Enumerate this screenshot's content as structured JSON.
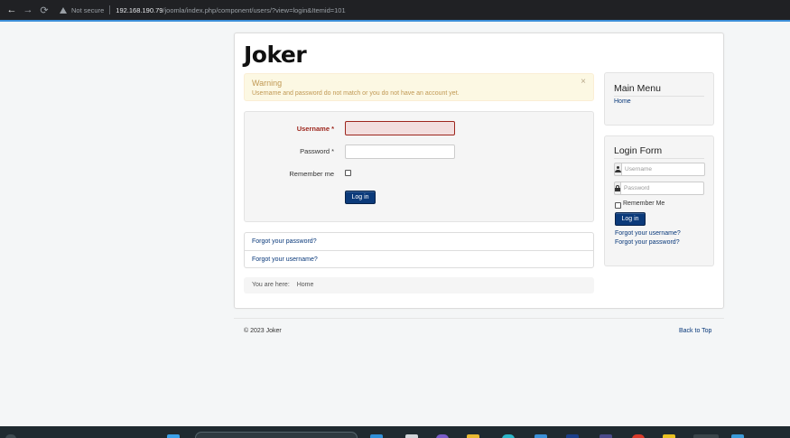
{
  "browser": {
    "security_label": "Not secure",
    "url_host": "192.168.190.79",
    "url_path": "/joomla/index.php/component/users/?view=login&Itemid=101"
  },
  "site": {
    "title": "Joker"
  },
  "alert": {
    "heading": "Warning",
    "message": "Username and password do not match or you do not have an account yet.",
    "close": "×"
  },
  "login": {
    "username_label": "Username *",
    "password_label": "Password *",
    "remember_label": "Remember me",
    "submit_label": "Log in",
    "username_value": "",
    "password_value": ""
  },
  "links": {
    "forgot_password": "Forgot your password?",
    "forgot_username": "Forgot your username?"
  },
  "breadcrumb": {
    "prefix": "You are here:",
    "home": "Home"
  },
  "main_menu": {
    "title": "Main Menu",
    "items": [
      {
        "label": "Home"
      }
    ]
  },
  "login_module": {
    "title": "Login Form",
    "username_placeholder": "Username",
    "password_placeholder": "Password",
    "remember_label": "Remember Me",
    "submit_label": "Log in",
    "forgot_username": "Forgot your username?",
    "forgot_password": "Forgot your password?"
  },
  "footer": {
    "copyright": "© 2023 Joker",
    "back_to_top": "Back to Top"
  },
  "colors": {
    "link": "#08387a",
    "primary_button": "#0b3a7a",
    "alert_bg": "#fcf8e3",
    "alert_text": "#c09853",
    "error_label": "#9d261d",
    "error_field_bg": "#f2dede"
  }
}
